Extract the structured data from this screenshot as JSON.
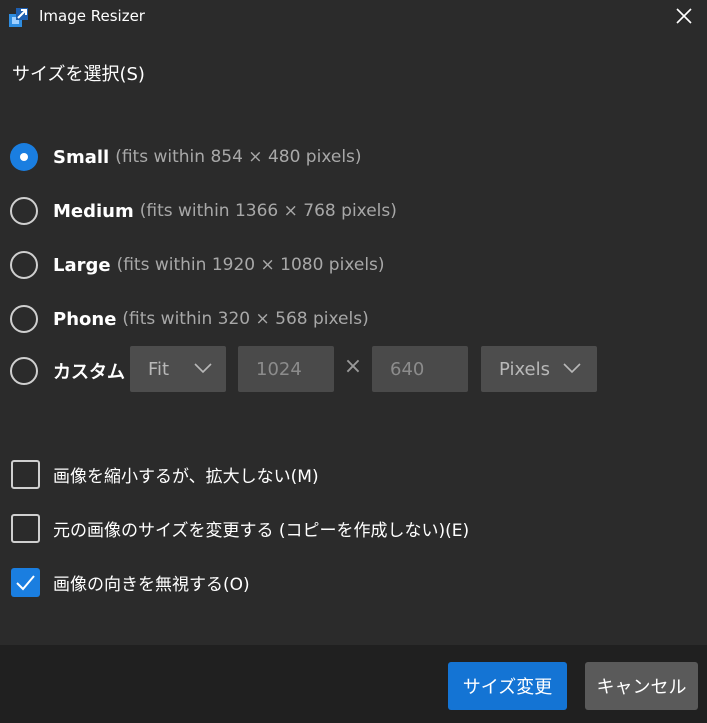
{
  "window": {
    "title": "Image Resizer"
  },
  "section": {
    "title": "サイズを選択(S)"
  },
  "sizes": [
    {
      "label": "Small",
      "desc": "(fits within 854 × 480 pixels)",
      "checked": true
    },
    {
      "label": "Medium",
      "desc": "(fits within 1366 × 768 pixels)",
      "checked": false
    },
    {
      "label": "Large",
      "desc": "(fits within 1920 × 1080 pixels)",
      "checked": false
    },
    {
      "label": "Phone",
      "desc": "(fits within 320 × 568 pixels)",
      "checked": false
    }
  ],
  "custom": {
    "label": "カスタム",
    "fit_mode": "Fit",
    "width": "1024",
    "times_symbol": "×",
    "height": "640",
    "unit": "Pixels"
  },
  "options": [
    {
      "label": "画像を縮小するが、拡大しない(M)",
      "checked": false
    },
    {
      "label": "元の画像のサイズを変更する (コピーを作成しない)(E)",
      "checked": false
    },
    {
      "label": "画像の向きを無視する(O)",
      "checked": true
    }
  ],
  "buttons": {
    "resize": "サイズ変更",
    "cancel": "キャンセル"
  },
  "colors": {
    "accent": "#1a7ee0",
    "background": "#2b2b2b",
    "footer": "#202020"
  },
  "icons": {
    "app": "image-resizer-icon",
    "close": "close-icon",
    "dropdown": "chevron-down-icon",
    "check": "checkmark-icon"
  }
}
